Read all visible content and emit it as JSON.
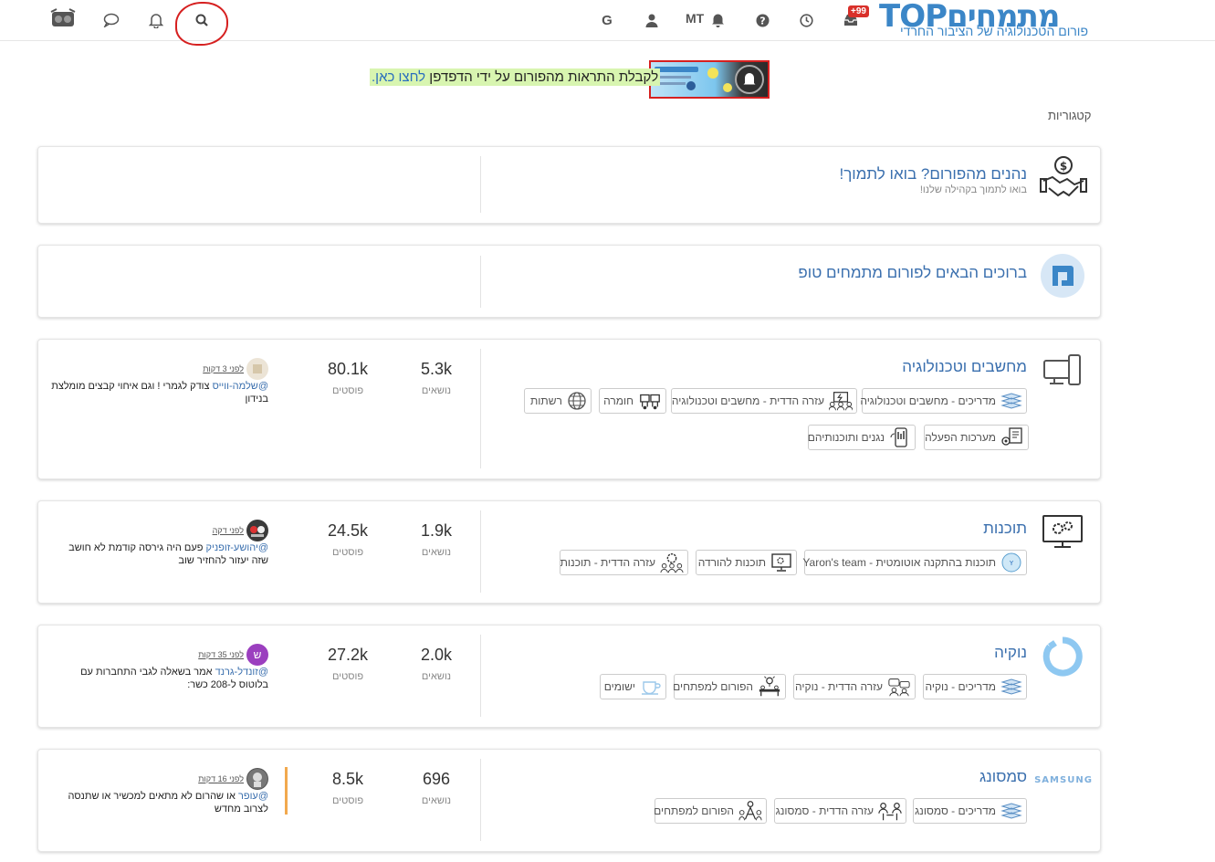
{
  "header": {
    "logo_brand": "TOPמתמחים",
    "logo_tagline": "פורום הטכנולוגיה של הציבור החרדי",
    "notification_badge": "+99",
    "user_initials": "MT",
    "icons": [
      "avatar-icon",
      "chat-icon",
      "bell-icon",
      "search-icon",
      "google-icon",
      "user-icon",
      "bell-icon",
      "help-icon",
      "clock-icon",
      "inbox-icon"
    ]
  },
  "banner": {
    "text": "לקבלת התראות מהפורום על ידי הדפדפן ",
    "link": "לחצו כאן."
  },
  "categories_heading": "קטגוריות",
  "categories": [
    {
      "title": "נהנים מהפורום? בואו לתמוך!",
      "description": "בואו לתמוך בקהילה שלנו!",
      "icon": "handshake-donation-icon"
    },
    {
      "title": "ברוכים הבאים לפורום מתמחים טופ",
      "icon": "forum-logo-icon"
    },
    {
      "title": "מחשבים וטכנולוגיה",
      "icon": "devices-icon",
      "topics": "5.3k",
      "posts": "80.1k",
      "topics_label": "נושאים",
      "posts_label": "פוסטים",
      "subcategories": [
        "מדריכים - מחשבים וטכנולוגיה",
        "עזרה הדדית - מחשבים וטכנולוגיה",
        "חומרה",
        "רשתות",
        "מערכות הפעלה",
        "נגנים ותוכנותיהם"
      ],
      "last_post": {
        "time": "לפני 3 דקות",
        "user": "@שלמה-ווייס",
        "text": "צודק לגמרי ! וגם איחוי קבצים מומלצת בנידון"
      }
    },
    {
      "title": "תוכנות",
      "icon": "software-settings-icon",
      "topics": "1.9k",
      "posts": "24.5k",
      "topics_label": "נושאים",
      "posts_label": "פוסטים",
      "subcategories": [
        "תוכנות בהתקנה אוטומטית - Yaron's team",
        "תוכנות להורדה",
        "עזרה הדדית - תוכנות"
      ],
      "last_post": {
        "time": "לפני דקה",
        "user": "@יהושע-זופניק",
        "text": "פעם היה גירסה קודמת לא חושב שזה יעזור להחזיר שוב"
      }
    },
    {
      "title": "נוקיה",
      "icon": "nokia-logo-icon",
      "topics": "2.0k",
      "posts": "27.2k",
      "topics_label": "נושאים",
      "posts_label": "פוסטים",
      "subcategories": [
        "מדריכים - נוקיה",
        "עזרה הדדית - נוקיה",
        "הפורום למפתחים",
        "ישומים"
      ],
      "last_post": {
        "time": "לפני 35 דקות",
        "user": "@זונדל-גרנד",
        "avatar_letter": "ש",
        "text": "אמר בשאלה לגבי התחברות עם בלוטוס ל-208 כשר:"
      }
    },
    {
      "title": "סמסונג",
      "icon": "samsung-logo-icon",
      "logo_text": "SAMSUNG",
      "topics": "696",
      "posts": "8.5k",
      "topics_label": "נושאים",
      "posts_label": "פוסטים",
      "subcategories": [
        "מדריכים - סמסונג",
        "עזרה הדדית - סמסונג",
        "הפורום למפתחים"
      ],
      "last_post": {
        "time": "לפני 16 דקות",
        "user": "@עופר",
        "text": "או שהרום לא מתאים למכשיר או שתנסה לצרוב מחדש"
      }
    }
  ],
  "colors": {
    "accent": "#3a6fae",
    "badge": "#d9302a",
    "highlight": "#d8f5b0",
    "annotation": "#d62020"
  }
}
